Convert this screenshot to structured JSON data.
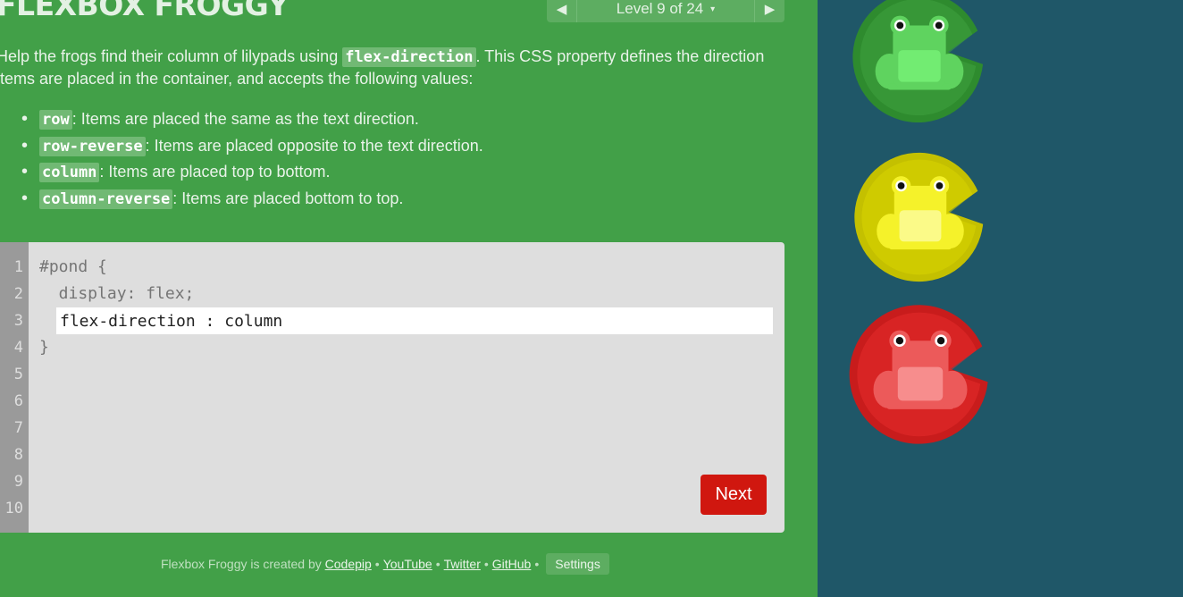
{
  "app": {
    "title": "FLEXBOX FROGGY"
  },
  "level": {
    "label": "Level 9 of 24",
    "prev_icon": "◀",
    "next_icon": "▶",
    "caret": "▾"
  },
  "instructions": {
    "intro_before": "Help the frogs find their column of lilypads using ",
    "intro_code": "flex-direction",
    "intro_after": ". This CSS property defines the direction items are placed in the container, and accepts the following values:",
    "values": [
      {
        "code": "row",
        "desc": ": Items are placed the same as the text direction."
      },
      {
        "code": "row-reverse",
        "desc": ": Items are placed opposite to the text direction."
      },
      {
        "code": "column",
        "desc": ": Items are placed top to bottom."
      },
      {
        "code": "column-reverse",
        "desc": ": Items are placed bottom to top."
      }
    ]
  },
  "editor": {
    "line_numbers": [
      "1",
      "2",
      "3",
      "4",
      "5",
      "6",
      "7",
      "8",
      "9",
      "10"
    ],
    "line1": "#pond {",
    "line2": "  display: flex;",
    "input_value": "flex-direction : column",
    "line4": "}",
    "next_label": "Next"
  },
  "footer": {
    "created_by": "Flexbox Froggy is created by",
    "codepip": "Codepip",
    "youtube": "YouTube",
    "twitter": "Twitter",
    "github": "GitHub",
    "separator": "•",
    "settings": "Settings"
  },
  "frogs": [
    {
      "color": "green",
      "lily": "#2e8b2e",
      "lily_light": "#3fa33f",
      "body": "#5fd35f",
      "belly": "#72ec72"
    },
    {
      "color": "yellow",
      "lily": "#c4c000",
      "lily_light": "#d9d400",
      "body": "#f5f22a",
      "belly": "#fbfa88"
    },
    {
      "color": "red",
      "lily": "#c81c1c",
      "lily_light": "#e62b2b",
      "body": "#ec5a5a",
      "belly": "#f78d8d"
    }
  ]
}
